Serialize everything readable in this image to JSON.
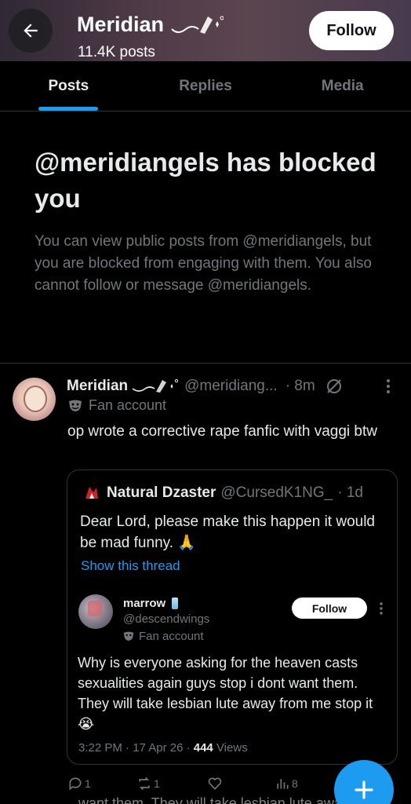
{
  "header": {
    "name": "Meridian",
    "name_decoration": "˜✧⋆˚",
    "post_count": "11.4K posts",
    "follow_label": "Follow"
  },
  "tabs": [
    {
      "label": "Posts",
      "active": true
    },
    {
      "label": "Replies",
      "active": false
    },
    {
      "label": "Media",
      "active": false
    }
  ],
  "blocked": {
    "title": "@meridiangels has blocked you",
    "message": "You can view public posts from @meridiangels, but you are blocked from engaging with them. You also cannot follow or message @meridiangels."
  },
  "post": {
    "name": "Meridian",
    "handle": "@meridiang...",
    "time": "· 8m",
    "account_label": "Fan account",
    "text": "op wrote a corrective rape fanfic with vaggi btw",
    "quote": {
      "name": "Natural Dzaster",
      "handle": "@CursedK1NG_",
      "time": "· 1d",
      "text": "Dear Lord, please make this happen it would be mad funny. 🙏",
      "show_thread": "Show this thread",
      "inner": {
        "name": "marrow",
        "handle": "@descendwings",
        "account_label": "Fan account",
        "follow_label": "Follow",
        "text": "Why is everyone asking for the heaven casts sexualities again guys stop i dont want them. They will take lesbian lute away from me stop it 😭",
        "date": "3:22 PM · 17 Apr 26 ·",
        "views_count": "444",
        "views_label": "Views"
      }
    },
    "actions": {
      "replies": "1",
      "reposts": "1",
      "likes": "",
      "views": "8"
    }
  },
  "ghost_text": "want them. They will take lesbian lute away",
  "colors": {
    "accent": "#1d9bf0",
    "background": "#000000",
    "secondary_text": "#71767b"
  }
}
